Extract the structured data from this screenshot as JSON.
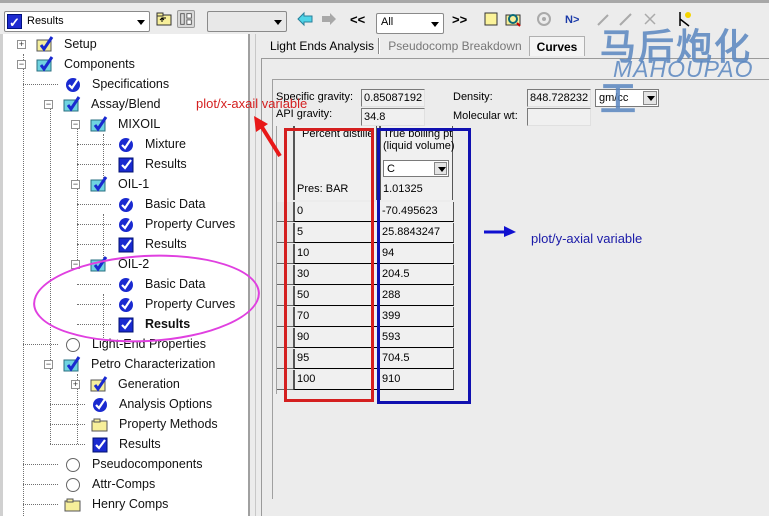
{
  "toolbar": {
    "form_selector": {
      "value": "Results",
      "checked": true
    },
    "second_combo": {
      "value": ""
    },
    "nav_prev": "<<",
    "filter_combo": {
      "value": "All"
    },
    "nav_next": ">>",
    "icons": [
      "folder-up-icon",
      "tree-view-icon",
      "back-arrow-icon",
      "forward-arrow-icon",
      "new-form-icon",
      "data-browser-icon",
      "run-settings-icon",
      "next-icon",
      "wizard-icon",
      "edit-icon",
      "delete-icon",
      "model-library-icon"
    ]
  },
  "tree": {
    "items": [
      {
        "label": "Setup",
        "icon": "folder-check-yellow",
        "expander": "plus",
        "level": 0
      },
      {
        "label": "Components",
        "icon": "folder-check-cyan",
        "expander": "minus",
        "level": 0
      },
      {
        "label": "Specifications",
        "icon": "round-check",
        "level": 1
      },
      {
        "label": "Assay/Blend",
        "icon": "folder-check-cyan",
        "expander": "minus",
        "level": 1
      },
      {
        "label": "MIXOIL",
        "icon": "folder-check-cyan",
        "expander": "minus",
        "level": 2
      },
      {
        "label": "Mixture",
        "icon": "round-check",
        "level": 3
      },
      {
        "label": "Results",
        "icon": "square-check",
        "level": 3
      },
      {
        "label": "OIL-1",
        "icon": "folder-check-cyan",
        "expander": "minus",
        "level": 2
      },
      {
        "label": "Basic Data",
        "icon": "round-check",
        "level": 3
      },
      {
        "label": "Property Curves",
        "icon": "round-check",
        "level": 3
      },
      {
        "label": "Results",
        "icon": "square-check",
        "level": 3
      },
      {
        "label": "OIL-2",
        "icon": "folder-check-cyan",
        "expander": "minus",
        "level": 2
      },
      {
        "label": "Basic Data",
        "icon": "round-check",
        "level": 3
      },
      {
        "label": "Property Curves",
        "icon": "round-check",
        "level": 3
      },
      {
        "label": "Results",
        "icon": "square-check",
        "level": 3,
        "selected": true
      },
      {
        "label": "Light-End Properties",
        "icon": "empty-circle",
        "level": 1
      },
      {
        "label": "Petro Characterization",
        "icon": "folder-check-cyan",
        "expander": "minus",
        "level": 1
      },
      {
        "label": "Generation",
        "icon": "folder-check-yellow",
        "expander": "plus",
        "level": 2
      },
      {
        "label": "Analysis Options",
        "icon": "round-check",
        "level": 2
      },
      {
        "label": "Property Methods",
        "icon": "folder-yellow",
        "level": 2
      },
      {
        "label": "Results",
        "icon": "square-check",
        "level": 2
      },
      {
        "label": "Pseudocomponents",
        "icon": "empty-circle",
        "level": 1
      },
      {
        "label": "Attr-Comps",
        "icon": "empty-circle",
        "level": 1
      },
      {
        "label": "Henry Comps",
        "icon": "folder-yellow",
        "level": 1
      }
    ]
  },
  "tabs": [
    {
      "label": "Light Ends Analysis",
      "active": false
    },
    {
      "label": "Pseudocomp Breakdown",
      "active": false
    },
    {
      "label": "Curves",
      "active": true
    }
  ],
  "form": {
    "specific_gravity": {
      "label": "Specific gravity:",
      "value": "0.85087192"
    },
    "api_gravity": {
      "label": "API gravity:",
      "value": "34.8"
    },
    "density": {
      "label": "Density:",
      "value": "848.728232",
      "unit": "gm/cc"
    },
    "molecular_wt": {
      "label": "Molecular wt:",
      "value": ""
    }
  },
  "grid": {
    "col1_header": "Percent distilled",
    "col2_header_line1": "True boiling pt",
    "col2_header_line2": "(liquid volume)",
    "col2_unit": "C",
    "pressure_label": "Pres: BAR",
    "pressure_value": "1.01325",
    "rows": [
      {
        "percent": "0",
        "tbp": "-70.495623"
      },
      {
        "percent": "5",
        "tbp": "25.8843247"
      },
      {
        "percent": "10",
        "tbp": "94"
      },
      {
        "percent": "30",
        "tbp": "204.5"
      },
      {
        "percent": "50",
        "tbp": "288"
      },
      {
        "percent": "70",
        "tbp": "399"
      },
      {
        "percent": "90",
        "tbp": "593"
      },
      {
        "percent": "95",
        "tbp": "704.5"
      },
      {
        "percent": "100",
        "tbp": "910"
      }
    ]
  },
  "annotations": {
    "x_label": "plot/x-axail variable",
    "y_label": "plot/y-axial variable",
    "colors": {
      "red": "#d41f1f",
      "blue": "#1010b0",
      "magenta": "#e040e0"
    }
  },
  "watermark": {
    "cn": "马后炮化工",
    "en": "MAHOUPAO"
  }
}
